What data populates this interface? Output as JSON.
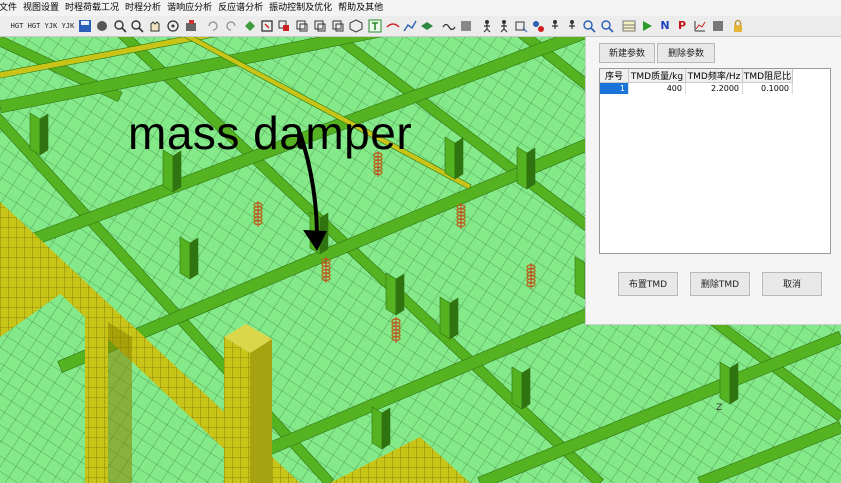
{
  "menu": [
    "文件",
    "视图设置",
    "时程荷载工况",
    "时程分析",
    "谐响应分析",
    "反应谱分析",
    "振动控制及优化",
    "帮助及其他"
  ],
  "toolbar": {
    "text_icons": [
      "HGT",
      "HGT",
      "YJK",
      "YJK"
    ],
    "letter_icons": [
      "N",
      "P"
    ],
    "icon_names": [
      "hgt-icon",
      "hgt-icon",
      "yjk-icon",
      "yjk-icon",
      "save-icon",
      "hand-icon",
      "zoom-in-icon",
      "zoom-out-icon",
      "pan-icon",
      "rotate-icon",
      "undo-icon",
      "redo-icon",
      "select-icon",
      "box-icon",
      "cube-icon",
      "node-icon",
      "line-icon",
      "plane-icon",
      "wave-icon",
      "person-icon",
      "chart-icon",
      "play-icon",
      "n-icon",
      "p-icon",
      "lock-icon"
    ]
  },
  "annotation": {
    "text": "mass damper"
  },
  "dialog": {
    "buttons": {
      "new_param": "新建参数",
      "delete_param": "删除参数",
      "place_tmd": "布置TMD",
      "delete_tmd": "删除TMD",
      "cancel": "取消"
    },
    "table": {
      "columns": [
        "序号",
        "TMD质量/kg",
        "TMD频率/Hz",
        "TMD阻尼比"
      ],
      "rows": [
        {
          "index": "1",
          "mass": "400",
          "freq": "2.2000",
          "damping": "0.1000"
        }
      ]
    }
  },
  "colors": {
    "mesh_fill": "#84e989",
    "mesh_line": "#1f5a21",
    "beam": "#55b321",
    "beam_dark": "#2f7410",
    "column": "#c9c418",
    "column_dark": "#8a8500",
    "damper": "#b36a1f",
    "selection": "#1a73d9"
  }
}
